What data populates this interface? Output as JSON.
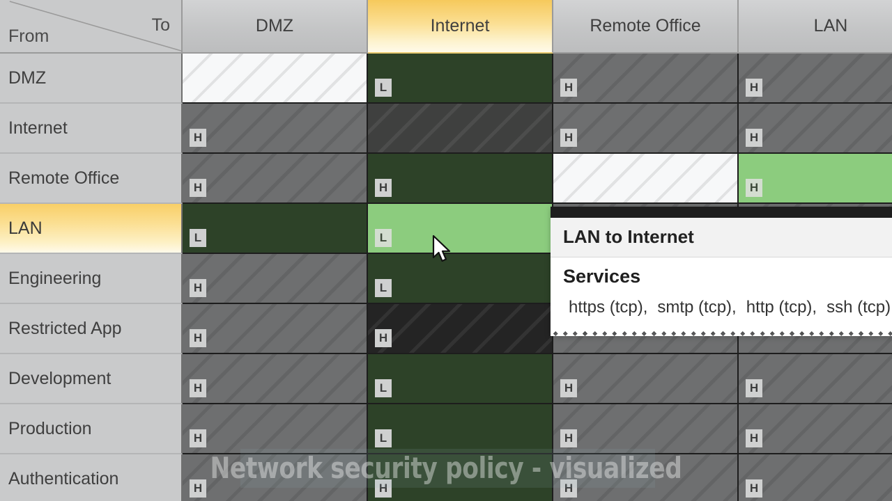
{
  "matrix": {
    "corner": {
      "to_label": "To",
      "from_label": "From"
    },
    "columns": [
      {
        "label": "DMZ",
        "selected": false
      },
      {
        "label": "Internet",
        "selected": true
      },
      {
        "label": "Remote Office",
        "selected": false
      },
      {
        "label": "LAN",
        "selected": false
      }
    ],
    "rows": [
      {
        "label": "DMZ",
        "selected": false
      },
      {
        "label": "Internet",
        "selected": false
      },
      {
        "label": "Remote Office",
        "selected": false
      },
      {
        "label": "LAN",
        "selected": true
      },
      {
        "label": "Engineering",
        "selected": false
      },
      {
        "label": "Restricted App",
        "selected": false
      },
      {
        "label": "Development",
        "selected": false
      },
      {
        "label": "Production",
        "selected": false
      },
      {
        "label": "Authentication",
        "selected": false
      }
    ],
    "cells": [
      [
        {
          "fill": "white",
          "badge": "",
          "hatch": true
        },
        {
          "fill": "dgreen",
          "badge": "L",
          "hatch": false
        },
        {
          "fill": "gray",
          "badge": "H",
          "hatch": true
        },
        {
          "fill": "gray",
          "badge": "H",
          "hatch": true
        }
      ],
      [
        {
          "fill": "gray",
          "badge": "H",
          "hatch": true
        },
        {
          "fill": "darkgray",
          "badge": "",
          "hatch": true
        },
        {
          "fill": "gray",
          "badge": "H",
          "hatch": true
        },
        {
          "fill": "gray",
          "badge": "H",
          "hatch": true
        }
      ],
      [
        {
          "fill": "gray",
          "badge": "H",
          "hatch": true
        },
        {
          "fill": "dgreen",
          "badge": "H",
          "hatch": false
        },
        {
          "fill": "white",
          "badge": "",
          "hatch": true
        },
        {
          "fill": "lgreen",
          "badge": "H",
          "hatch": false
        }
      ],
      [
        {
          "fill": "dgreen",
          "badge": "L",
          "hatch": false
        },
        {
          "fill": "lgreen",
          "badge": "L",
          "hatch": false
        },
        {
          "fill": "gray",
          "badge": "",
          "hatch": true
        },
        {
          "fill": "gray",
          "badge": "",
          "hatch": true
        }
      ],
      [
        {
          "fill": "gray",
          "badge": "H",
          "hatch": true
        },
        {
          "fill": "dgreen",
          "badge": "L",
          "hatch": false
        },
        {
          "fill": "gray",
          "badge": "",
          "hatch": true
        },
        {
          "fill": "gray",
          "badge": "",
          "hatch": true
        }
      ],
      [
        {
          "fill": "gray",
          "badge": "H",
          "hatch": true
        },
        {
          "fill": "black",
          "badge": "H",
          "hatch": true
        },
        {
          "fill": "gray",
          "badge": "",
          "hatch": true
        },
        {
          "fill": "gray",
          "badge": "",
          "hatch": true
        }
      ],
      [
        {
          "fill": "gray",
          "badge": "H",
          "hatch": true
        },
        {
          "fill": "dgreen",
          "badge": "L",
          "hatch": false
        },
        {
          "fill": "gray",
          "badge": "H",
          "hatch": true
        },
        {
          "fill": "gray",
          "badge": "H",
          "hatch": true
        }
      ],
      [
        {
          "fill": "gray",
          "badge": "H",
          "hatch": true
        },
        {
          "fill": "dgreen",
          "badge": "L",
          "hatch": false
        },
        {
          "fill": "gray",
          "badge": "H",
          "hatch": true
        },
        {
          "fill": "gray",
          "badge": "H",
          "hatch": true
        }
      ],
      [
        {
          "fill": "gray",
          "badge": "H",
          "hatch": true
        },
        {
          "fill": "dgreen",
          "badge": "H",
          "hatch": false
        },
        {
          "fill": "gray",
          "badge": "H",
          "hatch": true
        },
        {
          "fill": "gray",
          "badge": "H",
          "hatch": true
        }
      ]
    ]
  },
  "tooltip": {
    "title": "LAN to Internet",
    "section_label": "Services",
    "services": [
      "https (tcp),",
      "smtp (tcp),",
      "http (tcp),",
      "ssh (tcp)"
    ]
  },
  "watermark": {
    "text": "Network security policy - visualized"
  },
  "colors": {
    "highlight": "#f8cf67",
    "allow_low": "#2d4228",
    "allow_hover": "#8ccc7e",
    "deny": "#6e6f70",
    "blocked": "#242424",
    "empty": "#f7f8f9",
    "grid_line": "#1d1d1d"
  }
}
